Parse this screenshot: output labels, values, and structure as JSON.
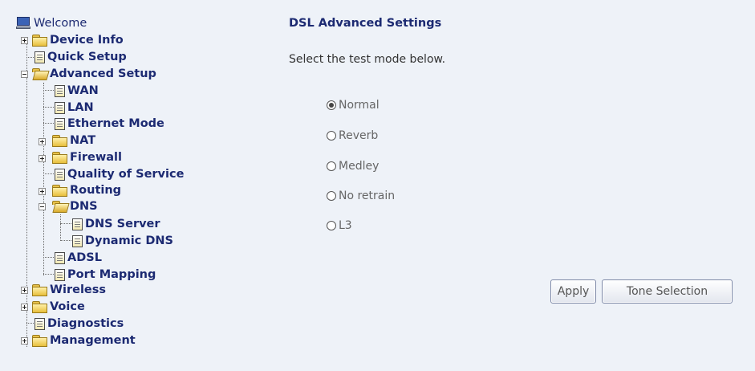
{
  "nav_tree": {
    "welcome": "Welcome",
    "device_info": "Device Info",
    "quick_setup": "Quick Setup",
    "advanced_setup": "Advanced Setup",
    "wan": "WAN",
    "lan": "LAN",
    "ethernet_mode": "Ethernet Mode",
    "nat": "NAT",
    "firewall": "Firewall",
    "quality_of_service": "Quality of Service",
    "routing": "Routing",
    "dns": "DNS",
    "dns_server": "DNS Server",
    "dynamic_dns": "Dynamic DNS",
    "adsl": "ADSL",
    "port_mapping": "Port Mapping",
    "wireless": "Wireless",
    "voice": "Voice",
    "diagnostics": "Diagnostics",
    "management": "Management"
  },
  "page": {
    "title": "DSL Advanced Settings",
    "subtitle": "Select the test mode below."
  },
  "test_modes": {
    "options": [
      "Normal",
      "Reverb",
      "Medley",
      "No retrain",
      "L3"
    ],
    "selected": "Normal"
  },
  "buttons": {
    "apply": "Apply",
    "tone_selection": "Tone Selection"
  }
}
